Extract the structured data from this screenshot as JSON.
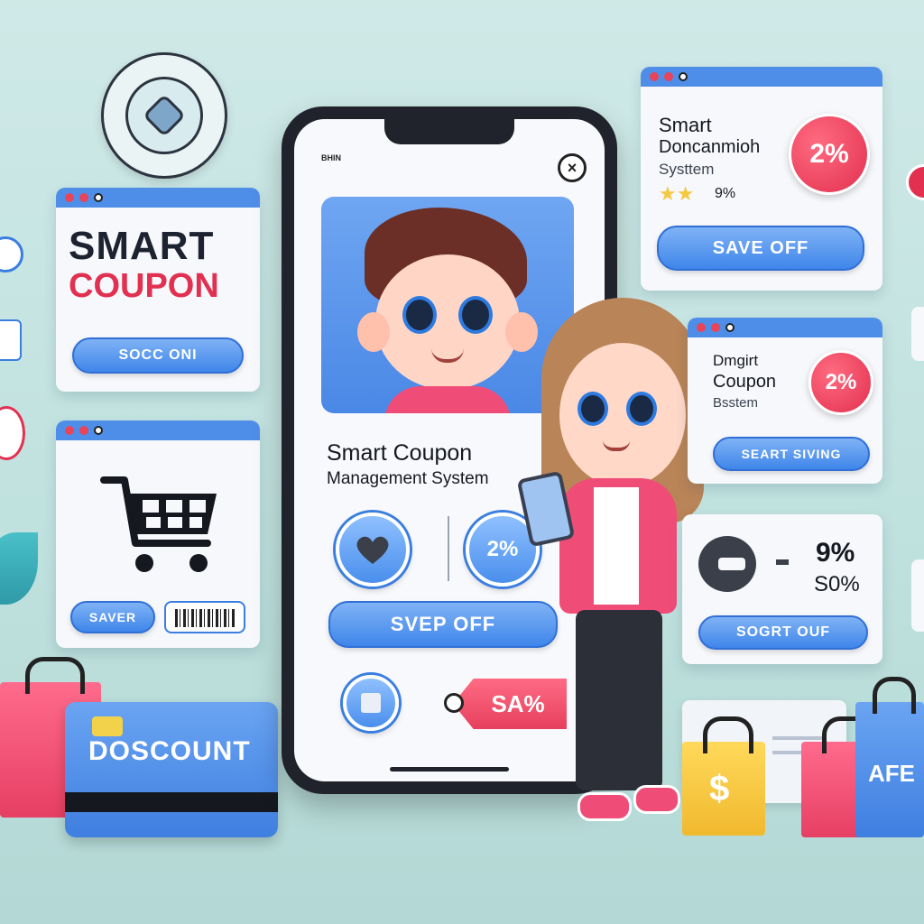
{
  "left_coupon": {
    "title_line1": "SMART",
    "title_line2": "COUPON",
    "button_label": "SOCC ONI"
  },
  "cart_panel": {
    "button_label": "SAVER"
  },
  "card": {
    "label": "DOSCOUNT"
  },
  "phone": {
    "status_text": "BHIN",
    "heading_line1": "Smart Coupon",
    "heading_line2": "Management System",
    "percent_badge": "2%",
    "primary_button": "SVEP OFF",
    "tag_label": "SA%"
  },
  "right_top_panel": {
    "line1": "Smart",
    "line2": "Doncanmioh",
    "line3": "Systtem",
    "rating_text": "9%",
    "badge": "2%",
    "button_label": "SAVE OFF"
  },
  "right_mid_panel": {
    "line1": "Dmgirt",
    "line2": "Coupon",
    "line3": "Bsstem",
    "badge": "2%",
    "button_label": "SEART SIVING"
  },
  "right_low_panel": {
    "value1": "9%",
    "value2": "S0%",
    "button_label": "SOGRT OUF"
  },
  "bag_labels": {
    "dollar": "$",
    "right_bag": "AFE"
  },
  "colors": {
    "accent_blue": "#4f8ee8",
    "accent_red": "#e23050",
    "pink": "#f25c83",
    "yellow": "#f5c842"
  }
}
